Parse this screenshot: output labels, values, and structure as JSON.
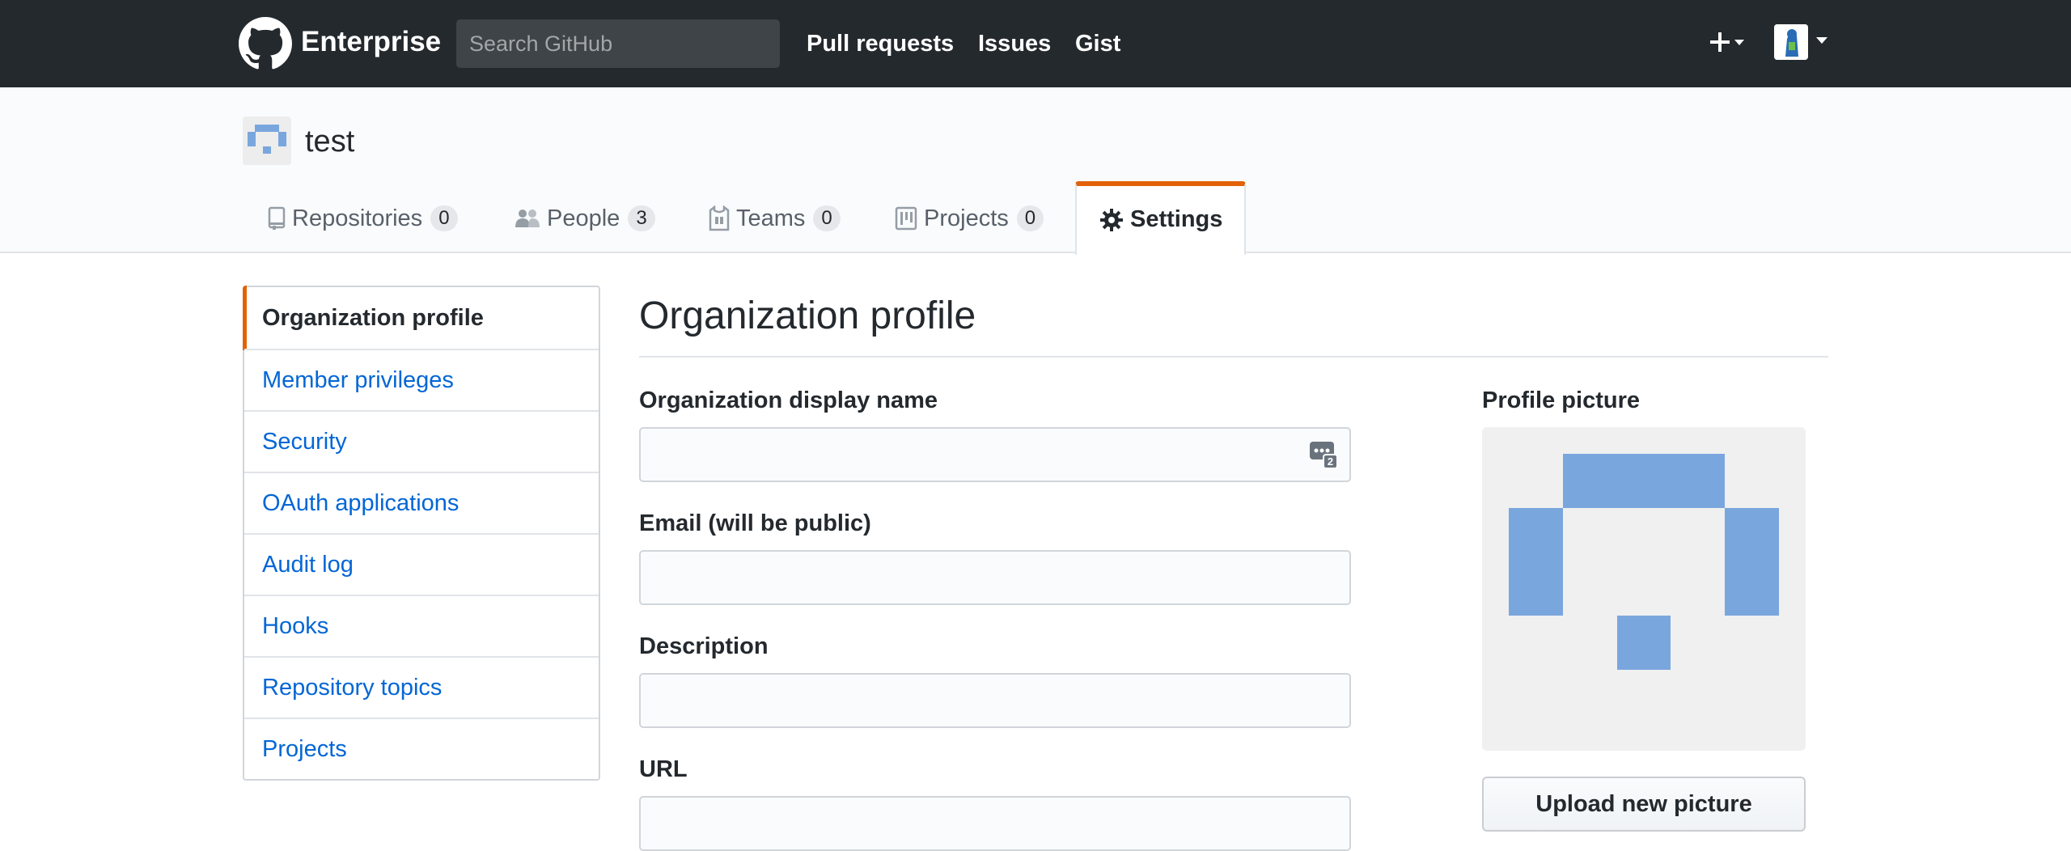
{
  "header": {
    "brand": "Enterprise",
    "search_placeholder": "Search GitHub",
    "nav": [
      "Pull requests",
      "Issues",
      "Gist"
    ]
  },
  "org": {
    "name": "test",
    "tabs": [
      {
        "label": "Repositories",
        "count": "0"
      },
      {
        "label": "People",
        "count": "3"
      },
      {
        "label": "Teams",
        "count": "0"
      },
      {
        "label": "Projects",
        "count": "0"
      },
      {
        "label": "Settings"
      }
    ]
  },
  "sidebar": {
    "items": [
      {
        "label": "Organization profile"
      },
      {
        "label": "Member privileges"
      },
      {
        "label": "Security"
      },
      {
        "label": "OAuth applications"
      },
      {
        "label": "Audit log"
      },
      {
        "label": "Hooks"
      },
      {
        "label": "Repository topics"
      },
      {
        "label": "Projects"
      }
    ]
  },
  "main": {
    "title": "Organization profile",
    "fields": [
      {
        "label": "Organization display name",
        "value": ""
      },
      {
        "label": "Email (will be public)",
        "value": ""
      },
      {
        "label": "Description",
        "value": ""
      },
      {
        "label": "URL",
        "value": ""
      }
    ],
    "profile_picture": {
      "label": "Profile picture",
      "upload_label": "Upload new picture"
    }
  },
  "colors": {
    "header_bg": "#24292e",
    "accent": "#e36209",
    "link": "#0366d6",
    "identicon": "#7aa6de"
  }
}
